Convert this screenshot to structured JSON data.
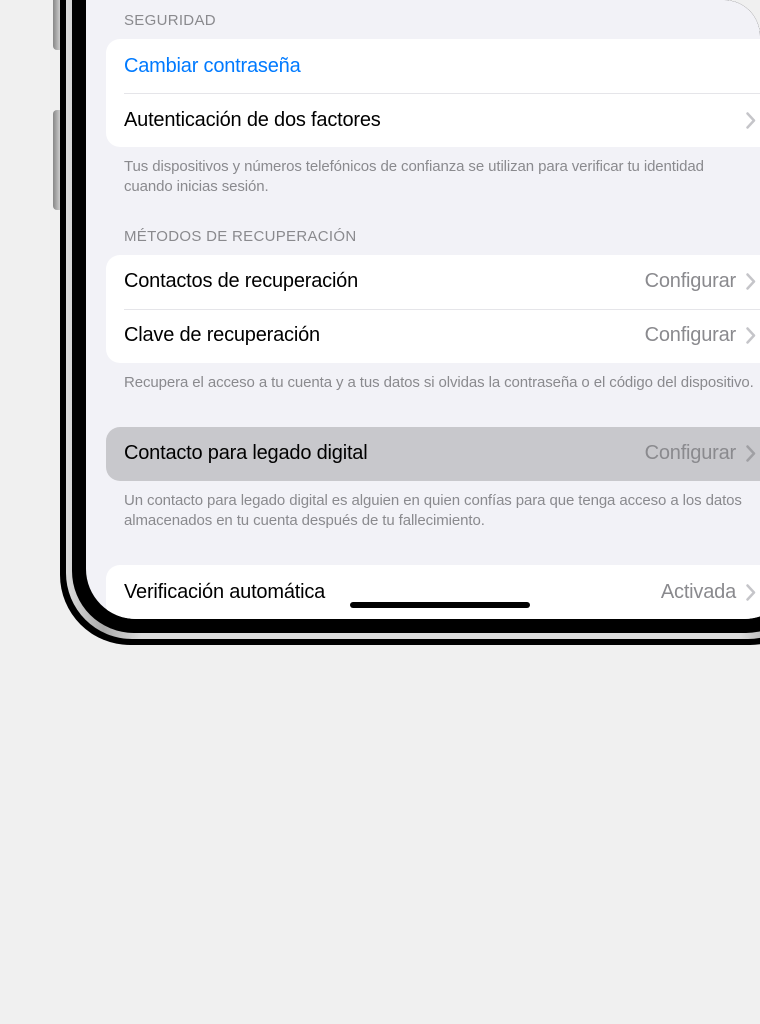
{
  "sections": {
    "security": {
      "header": "SEGURIDAD",
      "rows": {
        "change_password": {
          "label": "Cambiar contraseña"
        },
        "two_factor": {
          "label": "Autenticación de dos factores"
        }
      },
      "footer": "Tus dispositivos y números telefónicos de confianza se utilizan para verificar tu identidad cuando inicias sesión."
    },
    "recovery": {
      "header": "MÉTODOS DE RECUPERACIÓN",
      "rows": {
        "recovery_contacts": {
          "label": "Contactos de recuperación",
          "value": "Configurar"
        },
        "recovery_key": {
          "label": "Clave de recuperación",
          "value": "Configurar"
        }
      },
      "footer": "Recupera el acceso a tu cuenta y a tus datos si olvidas la contraseña o el código del dispositivo."
    },
    "legacy": {
      "rows": {
        "legacy_contact": {
          "label": "Contacto para legado digital",
          "value": "Configurar"
        }
      },
      "footer": "Un contacto para legado digital es alguien en quien confías para que tenga acceso a los datos almacenados en tu cuenta después de tu fallecimiento."
    },
    "verification": {
      "rows": {
        "auto_verification": {
          "label": "Verificación automática",
          "value": "Activada"
        }
      }
    }
  }
}
